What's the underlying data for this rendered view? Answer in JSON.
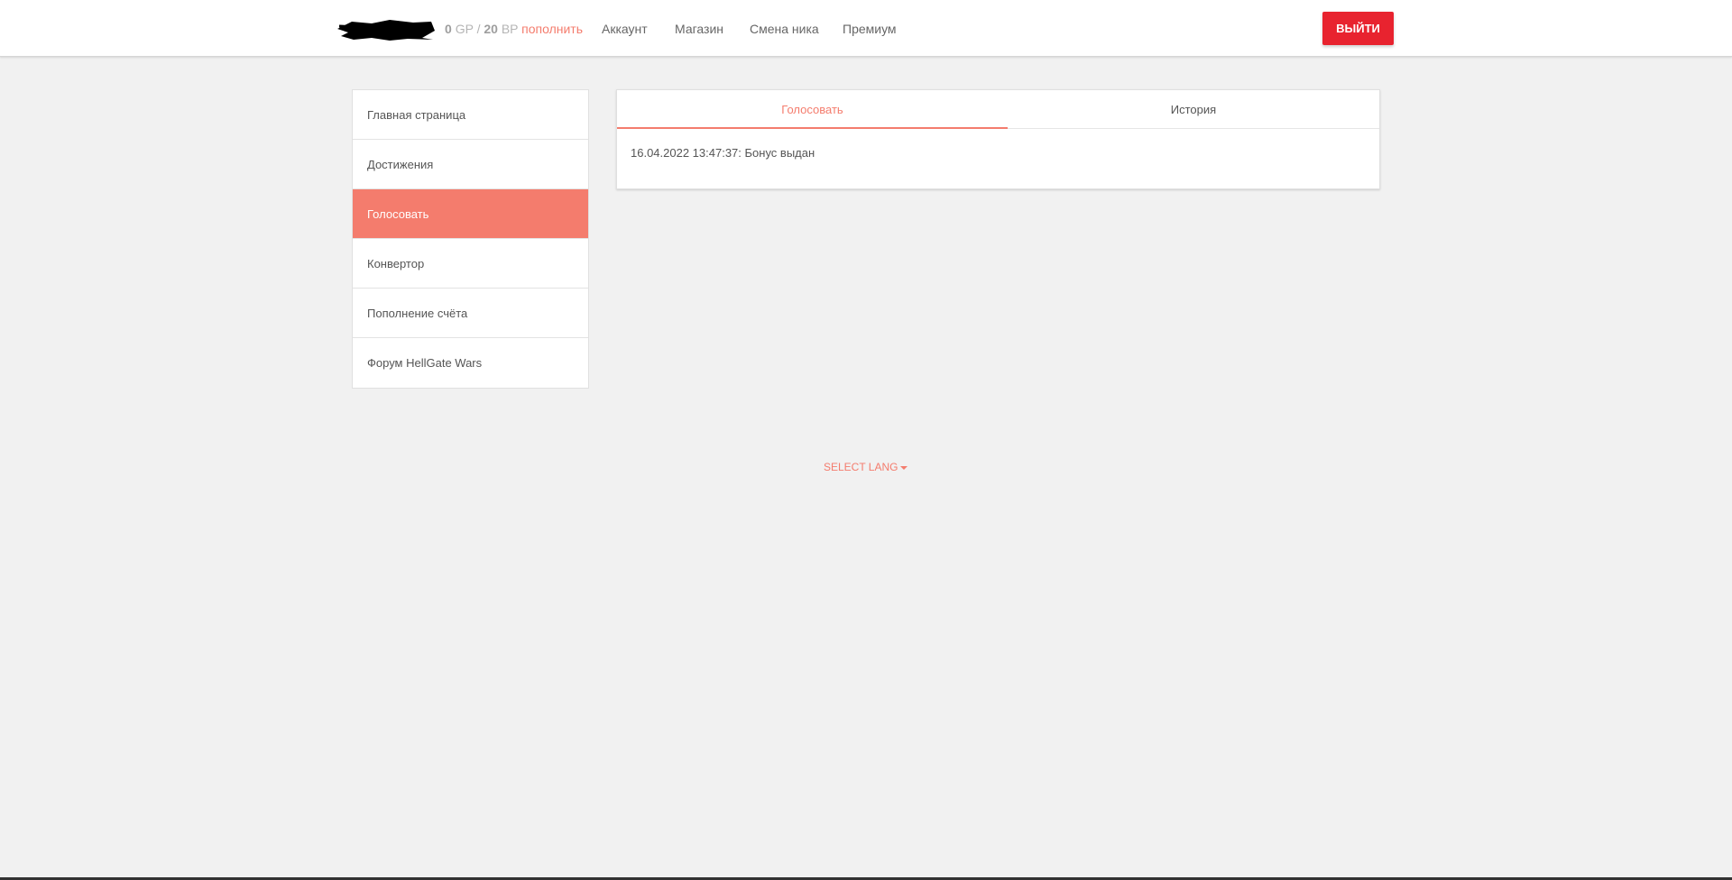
{
  "header": {
    "balance": {
      "gp_value": "0",
      "gp_unit": "GP",
      "separator": "/",
      "bp_value": "20",
      "bp_unit": "BP",
      "topup_label": "пополнить"
    },
    "nav": [
      {
        "label": "Аккаунт"
      },
      {
        "label": "Магазин"
      },
      {
        "label": "Смена ника"
      },
      {
        "label": "Премиум"
      }
    ],
    "logout_label": "Выйти"
  },
  "sidebar": {
    "items": [
      {
        "label": "Главная страница"
      },
      {
        "label": "Достижения"
      },
      {
        "label": "Голосовать",
        "active": true
      },
      {
        "label": "Конвертор"
      },
      {
        "label": "Пополнение счёта"
      },
      {
        "label": "Форум HellGate Wars"
      }
    ]
  },
  "main": {
    "tabs": [
      {
        "label": "Голосовать",
        "active": true
      },
      {
        "label": "История"
      }
    ],
    "history": [
      "16.04.2022 13:47:37: Бонус выдан"
    ]
  },
  "footer": {
    "lang_label": "Select lang"
  },
  "colors": {
    "accent": "#f47c6d",
    "logout": "#e8232f",
    "background": "#f1f1f1"
  },
  "icons": {
    "redacted_username": "redacted-username-scribble",
    "lang_caret": "caret-down-icon"
  }
}
